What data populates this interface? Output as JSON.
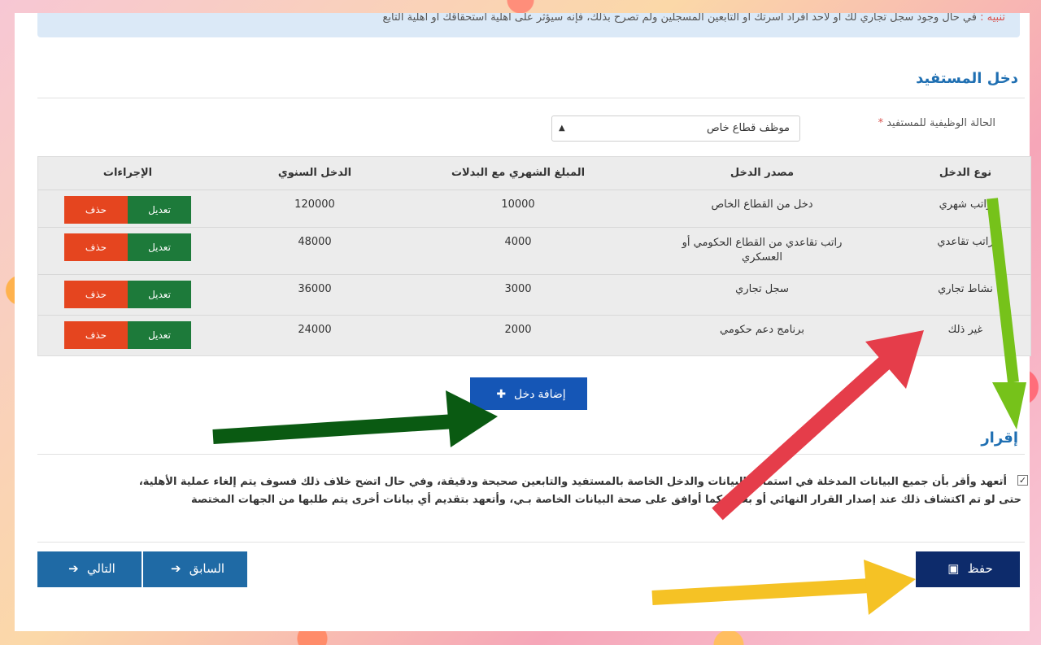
{
  "notice": {
    "label": "تنبيه :",
    "text": "في حال وجود سجل تجاري لك أو لأحد أفراد أسرتك أو التابعين المسجلين ولم تصرح بذلك، فإنه سيؤثر على أهلية استحقاقك أو أهلية التابع"
  },
  "income_section": {
    "title": "دخل المستفيد",
    "employment_label": "الحالة الوظيفية للمستفيد",
    "required_mark": "*",
    "employment_value": "موظف قطاع خاص"
  },
  "table": {
    "headers": [
      "نوع الدخل",
      "مصدر الدخل",
      "المبلغ الشهري مع البدلات",
      "الدخل السنوي",
      "الإجراءات"
    ],
    "rows": [
      {
        "type": "راتب شهري",
        "source": "دخل من القطاع الخاص",
        "monthly": "10000",
        "annual": "120000"
      },
      {
        "type": "راتب تقاعدي",
        "source": "راتب تقاعدي من القطاع الحكومي أو العسكري",
        "monthly": "4000",
        "annual": "48000"
      },
      {
        "type": "نشاط تجاري",
        "source": "سجل تجاري",
        "monthly": "3000",
        "annual": "36000"
      },
      {
        "type": "غير ذلك",
        "source": "برنامج دعم حكومي",
        "monthly": "2000",
        "annual": "24000"
      }
    ],
    "edit_label": "تعديل",
    "delete_label": "حذف"
  },
  "add_income_label": "إضافة دخل",
  "declaration": {
    "title": "إقرار",
    "line1": "أتعهد وأقر بأن جميع البيانات المدخلة في استمارة البيانات والدخل الخاصة بالمستفيد والتابعين صحيحة ودقيقة، وفي حال اتضح خلاف ذلك فسوف يتم إلغاء عملية الأهلية،",
    "line2": "حتى لو تم اكتشاف ذلك عند إصدار القرار النهائي أو بعده. كما أوافق على صحة البيانات الخاصة بـي، وأتعهد بتقديم أي بيانات أخرى يتم طلبها من الجهات المختصة"
  },
  "buttons": {
    "save": "حفظ",
    "previous": "السابق",
    "next": "التالي"
  },
  "colors": {
    "title": "#1f6fb2",
    "edit": "#1d7a3a",
    "delete": "#e5451f",
    "add": "#1556b6",
    "save": "#0d2b6b",
    "nav": "#1f6aa5"
  }
}
